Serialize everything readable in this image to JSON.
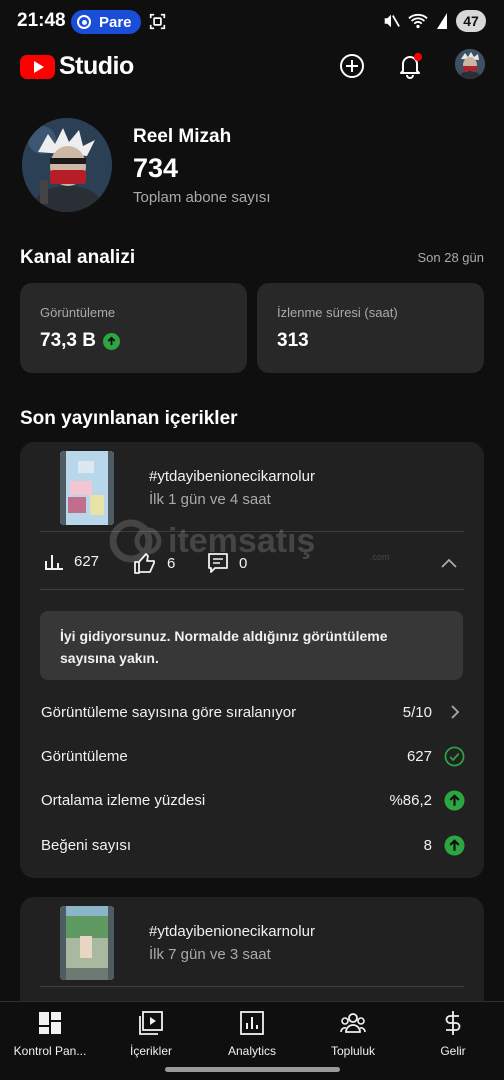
{
  "status_bar": {
    "time": "21:48",
    "pill_label": "Pare",
    "battery": "47",
    "icons": [
      "screen-record-icon",
      "mute-icon",
      "wifi-icon",
      "battery-icon"
    ]
  },
  "header": {
    "logo_text": "Studio",
    "brand_color": "#ff0000",
    "icons": [
      "create-icon",
      "bell-icon",
      "account-avatar"
    ]
  },
  "channel": {
    "name": "Reel Mizah",
    "subscriber_count": "734",
    "subscriber_label": "Toplam abone sayısı"
  },
  "analytics": {
    "title": "Kanal analizi",
    "period": "Son 28 gün",
    "metrics": [
      {
        "label": "Görüntüleme",
        "value": "73,3 B",
        "trend": "up"
      },
      {
        "label": "İzlenme süresi (saat)",
        "value": "313"
      }
    ]
  },
  "recent": {
    "title": "Son yayınlanan içerikler",
    "items": [
      {
        "title": "#ytdayibenionecikarnolur",
        "subtitle": "İlk 1 gün ve 4 saat",
        "views": "627",
        "likes": "6",
        "comments": "0",
        "tip": "İyi gidiyorsunuz. Normalde aldığınız görüntüleme sayısına yakın.",
        "rows": [
          {
            "label": "Görüntüleme sayısına göre sıralanıyor",
            "value": "5/10",
            "icon": "chevron-right-icon"
          },
          {
            "label": "Görüntüleme",
            "value": "627",
            "icon": "check-circle-icon"
          },
          {
            "label": "Ortalama izleme yüzdesi",
            "value": "%86,2",
            "icon": "arrow-up-circle-icon"
          },
          {
            "label": "Beğeni sayısı",
            "value": "8",
            "icon": "arrow-up-circle-icon"
          }
        ]
      },
      {
        "title": "#ytdayibenionecikarnolur",
        "subtitle": "İlk 7 gün ve 3 saat"
      }
    ]
  },
  "watermark": {
    "brand": "itemsatış",
    "suffix": ".com"
  },
  "bottom_nav": {
    "items": [
      {
        "label": "Kontrol Pan...",
        "icon": "dashboard-icon"
      },
      {
        "label": "İçerikler",
        "icon": "content-icon"
      },
      {
        "label": "Analytics",
        "icon": "analytics-icon"
      },
      {
        "label": "Topluluk",
        "icon": "community-icon"
      },
      {
        "label": "Gelir",
        "icon": "earn-icon"
      }
    ]
  }
}
